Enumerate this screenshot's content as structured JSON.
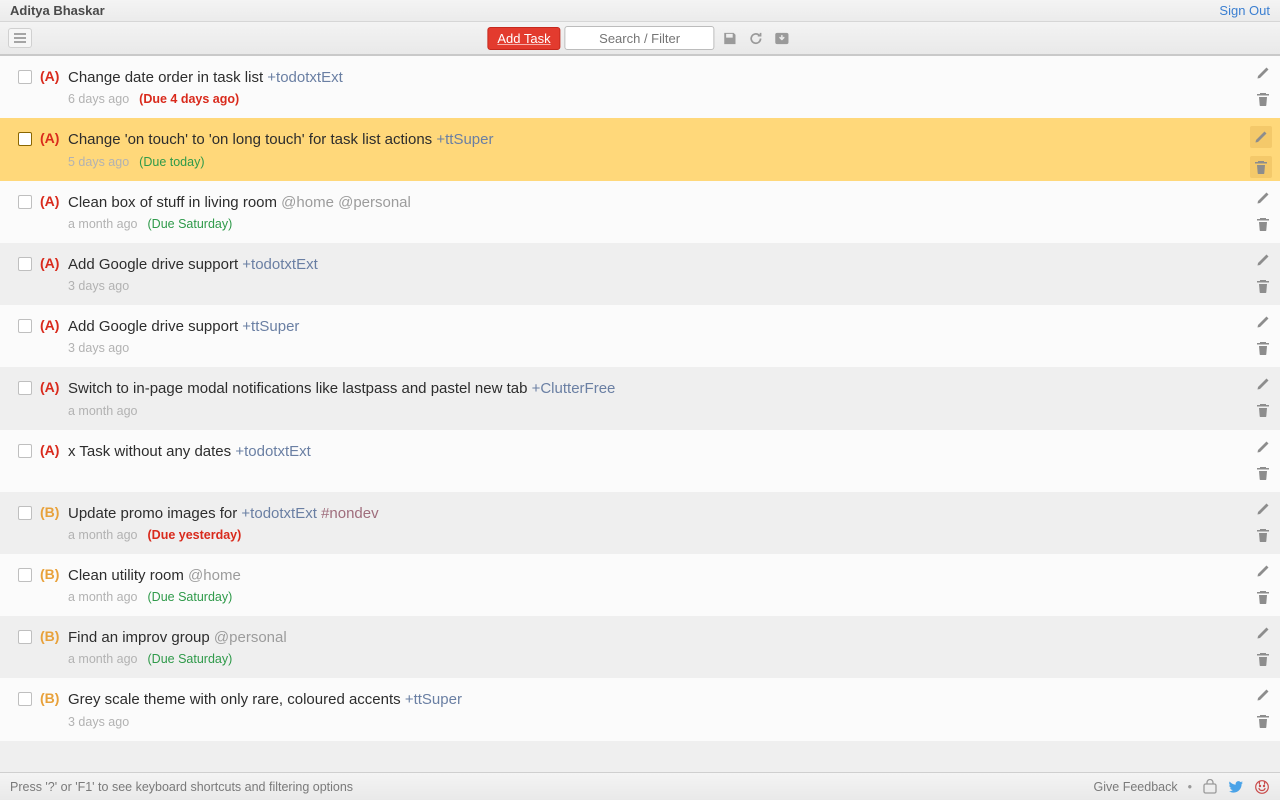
{
  "header": {
    "user_name": "Aditya Bhaskar",
    "signout": "Sign Out"
  },
  "toolbar": {
    "add_task": "Add Task",
    "search_placeholder": "Search / Filter"
  },
  "tasks": [
    {
      "priority": "(A)",
      "prio_class": "prio-A",
      "segments": [
        {
          "t": "Change date order in task list "
        },
        {
          "t": "+todotxtExt",
          "cls": "project"
        }
      ],
      "created": "6 days ago",
      "due": "(Due 4 days ago)",
      "due_class": "due-red",
      "stripe": "even",
      "selected": false
    },
    {
      "priority": "(A)",
      "prio_class": "prio-A",
      "segments": [
        {
          "t": "Change 'on touch' to 'on long touch' for task list actions "
        },
        {
          "t": "+ttSuper",
          "cls": "project"
        }
      ],
      "created": "5 days ago",
      "due": "(Due today)",
      "due_class": "due-green",
      "stripe": "odd",
      "selected": true
    },
    {
      "priority": "(A)",
      "prio_class": "prio-A",
      "segments": [
        {
          "t": "Clean box of stuff in living room "
        },
        {
          "t": "@home",
          "cls": "context"
        },
        {
          "t": " "
        },
        {
          "t": "@personal",
          "cls": "context"
        }
      ],
      "created": "a month ago",
      "due": "(Due Saturday)",
      "due_class": "due-green",
      "stripe": "even",
      "selected": false
    },
    {
      "priority": "(A)",
      "prio_class": "prio-A",
      "segments": [
        {
          "t": "Add Google drive support "
        },
        {
          "t": "+todotxtExt",
          "cls": "project"
        }
      ],
      "created": "3 days ago",
      "due": "",
      "due_class": "",
      "stripe": "odd",
      "selected": false
    },
    {
      "priority": "(A)",
      "prio_class": "prio-A",
      "segments": [
        {
          "t": "Add Google drive support "
        },
        {
          "t": "+ttSuper",
          "cls": "project"
        }
      ],
      "created": "3 days ago",
      "due": "",
      "due_class": "",
      "stripe": "even",
      "selected": false
    },
    {
      "priority": "(A)",
      "prio_class": "prio-A",
      "segments": [
        {
          "t": "Switch to in-page modal notifications like lastpass and pastel new tab "
        },
        {
          "t": "+ClutterFree",
          "cls": "project"
        }
      ],
      "created": "a month ago",
      "due": "",
      "due_class": "",
      "stripe": "odd",
      "selected": false
    },
    {
      "priority": "(A)",
      "prio_class": "prio-A",
      "segments": [
        {
          "t": "x Task without any dates "
        },
        {
          "t": "+todotxtExt",
          "cls": "project"
        }
      ],
      "created": "",
      "due": "",
      "due_class": "",
      "stripe": "even",
      "selected": false
    },
    {
      "priority": "(B)",
      "prio_class": "prio-B",
      "segments": [
        {
          "t": "Update promo images for "
        },
        {
          "t": "+todotxtExt",
          "cls": "project"
        },
        {
          "t": " "
        },
        {
          "t": "#nondev",
          "cls": "hashtag"
        }
      ],
      "created": "a month ago",
      "due": "(Due yesterday)",
      "due_class": "due-red",
      "stripe": "odd",
      "selected": false
    },
    {
      "priority": "(B)",
      "prio_class": "prio-B",
      "segments": [
        {
          "t": "Clean utility room "
        },
        {
          "t": "@home",
          "cls": "context"
        }
      ],
      "created": "a month ago",
      "due": "(Due Saturday)",
      "due_class": "due-green",
      "stripe": "even",
      "selected": false
    },
    {
      "priority": "(B)",
      "prio_class": "prio-B",
      "segments": [
        {
          "t": "Find an improv group "
        },
        {
          "t": "@personal",
          "cls": "context"
        }
      ],
      "created": "a month ago",
      "due": "(Due Saturday)",
      "due_class": "due-green",
      "stripe": "odd",
      "selected": false
    },
    {
      "priority": "(B)",
      "prio_class": "prio-B",
      "segments": [
        {
          "t": "Grey scale theme with only rare, coloured accents "
        },
        {
          "t": "+ttSuper",
          "cls": "project"
        }
      ],
      "created": "3 days ago",
      "due": "",
      "due_class": "",
      "stripe": "even",
      "selected": false
    }
  ],
  "statusbar": {
    "hint": "Press '?' or 'F1' to see keyboard shortcuts and filtering options",
    "feedback": "Give Feedback"
  }
}
